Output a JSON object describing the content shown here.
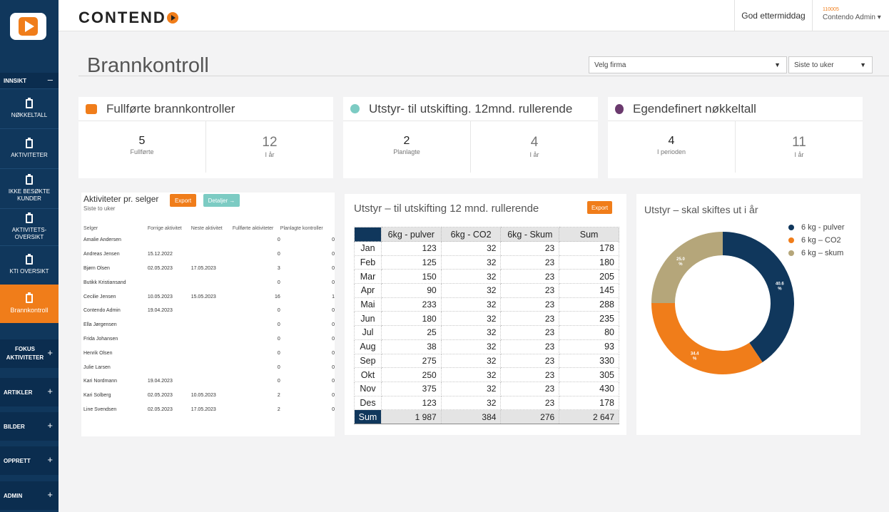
{
  "app": {
    "brand": "CONTEND",
    "greeting": "God ettermiddag",
    "user_id": "110005",
    "user_name": "Contendo Admin ▾"
  },
  "sidebar": {
    "insikt_label": "INNSIKT",
    "insikt_toggle": "–",
    "items": [
      {
        "label": "NØKKELTALL",
        "icon": "clipboard-icon"
      },
      {
        "label": "AKTIVITETER",
        "icon": "clipboard-icon"
      },
      {
        "label": "IKKE BESØKTE KUNDER",
        "icon": "building-icon"
      },
      {
        "label": "AKTIVITETS-OVERSIKT",
        "icon": "clipboard-icon"
      },
      {
        "label": "KTI OVERSIKT",
        "icon": "clipboard-icon"
      },
      {
        "label": "Brannkontroll",
        "icon": "clipboard-icon",
        "active": true
      }
    ],
    "sections": [
      {
        "label": "FOKUS AKTIVITETER",
        "toggle": "+"
      },
      {
        "label": "ARTIKLER",
        "toggle": "+"
      },
      {
        "label": "BILDER",
        "toggle": "+"
      },
      {
        "label": "OPPRETT",
        "toggle": "+"
      },
      {
        "label": "ADMIN",
        "toggle": "+"
      }
    ]
  },
  "page": {
    "title": "Brannkontroll",
    "company_select": "Velg firma",
    "period_select": "Siste to uker",
    "select_arrow": "▼"
  },
  "kpis": [
    {
      "title": "Fullførte  brannkontroller",
      "icon": "handshake-icon",
      "icon_color": "#f07d1a",
      "left_value": "5",
      "left_label": "Fullførte",
      "right_value": "12",
      "right_label": "I år"
    },
    {
      "title": "Utstyr- til utskifting. 12mnd. rullerende",
      "icon": "clock-icon",
      "icon_color": "#7ccbc3",
      "left_value": "2",
      "left_label": "Planlagte",
      "right_value": "4",
      "right_label": "I år"
    },
    {
      "title": "Egendefinert nøkkeltall",
      "icon": "award-icon",
      "icon_color": "#6b3a6e",
      "left_value": "4",
      "left_label": "I perioden",
      "right_value": "11",
      "right_label": "I år"
    }
  ],
  "sellers": {
    "title": "Aktiviteter pr. selger",
    "subtitle": "Siste to uker",
    "export_label": "Export",
    "details_label": "Detaljer →",
    "columns": [
      "Selger",
      "Forrige aktivitet",
      "Neste aktivitet",
      "Fullførte aktiviteter",
      "Planlagte kontroller"
    ],
    "rows": [
      [
        "Amalie Andersen",
        "",
        "",
        "0",
        "0"
      ],
      [
        "Andreas Jensen",
        "15.12.2022",
        "",
        "0",
        "0"
      ],
      [
        "Bjørn Olsen",
        "02.05.2023",
        "17.05.2023",
        "3",
        "0"
      ],
      [
        "Butikk Kristiansand",
        "",
        "",
        "0",
        "0"
      ],
      [
        "Cecilie Jensen",
        "10.05.2023",
        "15.05.2023",
        "16",
        "1"
      ],
      [
        "Contendo Admin",
        "19.04.2023",
        "",
        "0",
        "0"
      ],
      [
        "Ella Jørgensen",
        "",
        "",
        "0",
        "0"
      ],
      [
        "Frida Johansen",
        "",
        "",
        "0",
        "0"
      ],
      [
        "Henrik Olsen",
        "",
        "",
        "0",
        "0"
      ],
      [
        "Julie Larsen",
        "",
        "",
        "0",
        "0"
      ],
      [
        "Kari Nordmann",
        "19.04.2023",
        "",
        "0",
        "0"
      ],
      [
        "Kari Solberg",
        "02.05.2023",
        "10.05.2023",
        "2",
        "0"
      ],
      [
        "Line Svendsen",
        "02.05.2023",
        "17.05.2023",
        "2",
        "0"
      ]
    ]
  },
  "equipment": {
    "title": "Utstyr – til utskifting  12 mnd. rullerende",
    "export_label": "Export",
    "columns": [
      "",
      "6kg - pulver",
      "6kg - CO2",
      "6kg - Skum",
      "Sum"
    ],
    "rows": [
      [
        "Jan",
        "123",
        "32",
        "23",
        "178"
      ],
      [
        "Feb",
        "125",
        "32",
        "23",
        "180"
      ],
      [
        "Mar",
        "150",
        "32",
        "23",
        "205"
      ],
      [
        "Apr",
        "90",
        "32",
        "23",
        "145"
      ],
      [
        "Mai",
        "233",
        "32",
        "23",
        "288"
      ],
      [
        "Jun",
        "180",
        "32",
        "23",
        "235"
      ],
      [
        "Jul",
        "25",
        "32",
        "23",
        "80"
      ],
      [
        "Aug",
        "38",
        "32",
        "23",
        "93"
      ],
      [
        "Sep",
        "275",
        "32",
        "23",
        "330"
      ],
      [
        "Okt",
        "250",
        "32",
        "23",
        "305"
      ],
      [
        "Nov",
        "375",
        "32",
        "23",
        "430"
      ],
      [
        "Des",
        "123",
        "32",
        "23",
        "178"
      ]
    ],
    "sum_row": [
      "Sum",
      "1 987",
      "384",
      "276",
      "2 647"
    ]
  },
  "chart_data": {
    "type": "pie",
    "title": "Utstyr – skal skiftes ut i år",
    "hole": true,
    "legend_position": "top-right",
    "categories": [
      "6 kg - pulver",
      "6 kg – CO2",
      "6 kg – skum"
    ],
    "values": [
      40.6,
      34.4,
      25.0
    ],
    "labels": [
      "40.6 %",
      "34.4 %",
      "25.0 %"
    ],
    "colors": [
      "#10375c",
      "#f07d1a",
      "#b5a67a"
    ]
  }
}
